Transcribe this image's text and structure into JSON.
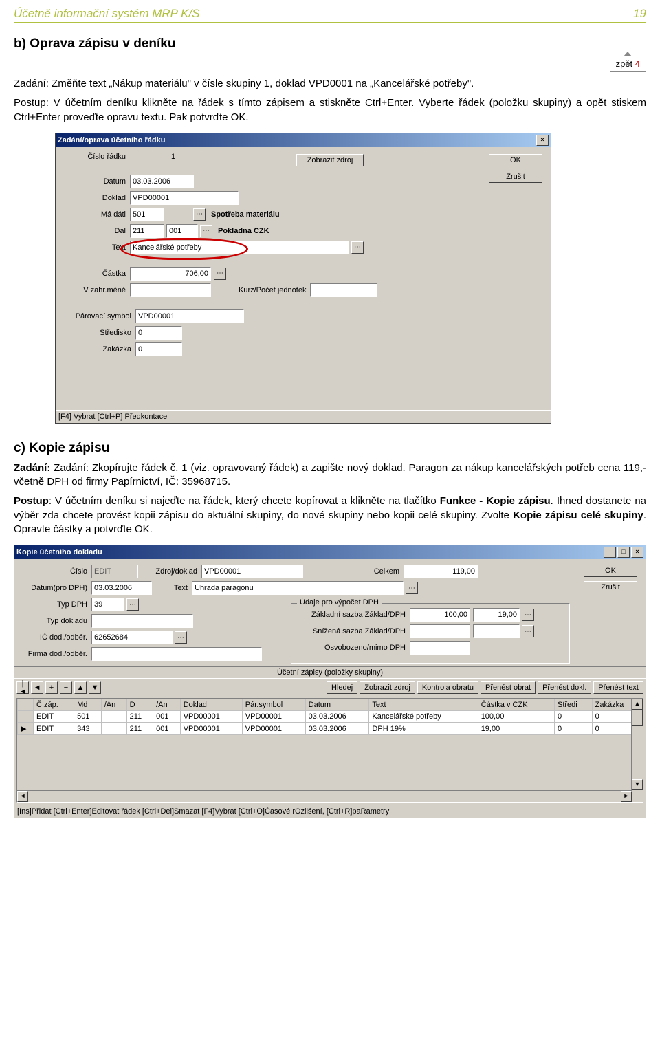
{
  "header": {
    "title": "Účetně informační systém MRP K/S",
    "page": "19"
  },
  "section_b": {
    "title": "b) Oprava zápisu v deníku",
    "back_label": "zpět ",
    "back_num": "4",
    "task": "Zadání: Změňte text „Nákup materiálu\" v čísle skupiny 1, doklad VPD0001 na „Kancelářské potřeby\".",
    "proc": "Postup:  V účetním deníku klikněte na řádek s tímto zápisem a stiskněte Ctrl+Enter. Vyberte řádek (položku skupiny) a  opět stiskem Ctrl+Enter proveďte opravu textu.  Pak potvrďte OK."
  },
  "dlg1": {
    "title": "Zadání/oprava účetního řádku",
    "btn_close": "×",
    "btn_show": "Zobrazit zdroj",
    "btn_ok": "OK",
    "btn_cancel": "Zrušit",
    "l_radek": "Číslo řádku",
    "v_radek": "1",
    "l_datum": "Datum",
    "v_datum": "03.03.2006",
    "l_doklad": "Doklad",
    "v_doklad": "VPD00001",
    "l_md": "Má dáti",
    "v_md": "501",
    "v_md_txt": "Spotřeba materiálu",
    "l_dal": "Dal",
    "v_dal1": "211",
    "v_dal2": "001",
    "v_dal_txt": "Pokladna CZK",
    "l_text": "Text",
    "v_text": "Kancelářské potřeby",
    "l_castka": "Částka",
    "v_castka": "706,00",
    "l_zahr": "V zahr.měně",
    "l_kurz": "Kurz/Počet jednotek",
    "l_par": "Párovací symbol",
    "v_par": "VPD00001",
    "l_str": "Středisko",
    "v_str": "0",
    "l_zak": "Zakázka",
    "v_zak": "0",
    "status": "[F4] Vybrat  [Ctrl+P] Předkontace"
  },
  "section_c": {
    "title": "c) Kopie zápisu",
    "p1": "Zadání: Zkopírujte řádek č. 1 (viz. opravovaný řádek) a zapište nový doklad. Paragon za nákup kancelářských potřeb cena 119,- včetně DPH od firmy Papírnictví, IČ: 35968715.",
    "p2a": "Postup",
    "p2b": ": V účetním deníku si najeďte na řádek, který chcete kopírovat a klikněte na tlačítko ",
    "p2c": "Funkce - Kopie zápisu",
    "p2d": ". Ihned dostanete na výběr zda chcete provést kopii zápisu do aktuální skupiny, do nové skupiny nebo kopii celé skupiny. Zvolte ",
    "p2e": "Kopie zápisu celé skupiny",
    "p2f": ". Opravte částky a potvrďte OK."
  },
  "dlg2": {
    "title": "Kopie účetního dokladu",
    "l_cislo": "Číslo",
    "v_cislo": "EDIT",
    "l_zdroj": "Zdroj/doklad",
    "v_zdroj": "VPD00001",
    "l_celkem": "Celkem",
    "v_celkem": "119,00",
    "btn_ok": "OK",
    "btn_cancel": "Zrušit",
    "l_datumdph": "Datum(pro DPH)",
    "v_datumdph": "03.03.2006",
    "l_text": "Text",
    "v_text": "Úhrada paragonu",
    "l_typdph": "Typ DPH",
    "v_typdph": "39",
    "l_typdok": "Typ dokladu",
    "l_ic": "IČ dod./odběr.",
    "v_ic": "62652684",
    "l_firma": "Firma dod./odběr.",
    "group_title": "Údaje pro výpočet DPH",
    "l_zs": "Základní sazba Základ/DPH",
    "v_zs1": "100,00",
    "v_zs2": "19,00",
    "l_ss": "Snížená sazba Základ/DPH",
    "l_osv": "Osvobozeno/mimo DPH",
    "innerbar": "Účetní zápisy (položky skupiny)",
    "tb": {
      "first": "|◄",
      "prev": "◄",
      "add": "+",
      "del": "−",
      "up": "▲",
      "down": "▼",
      "hledej": "Hledej",
      "zobr": "Zobrazit zdroj",
      "kontrola": "Kontrola obratu",
      "pren_obr": "Přenést obrat",
      "pren_dokl": "Přenést dokl.",
      "pren_txt": "Přenést text"
    },
    "cols": [
      "Č.záp.",
      "Md",
      "/An",
      "D",
      "/An",
      "Doklad",
      "Pár.symbol",
      "Datum",
      "Text",
      "Částka v CZK",
      "Středi",
      "Zakázka"
    ],
    "rows": [
      [
        "EDIT",
        "501",
        "",
        "211",
        "001",
        "VPD00001",
        "VPD00001",
        "03.03.2006",
        "Kancelářské potřeby",
        "100,00",
        "0",
        "0"
      ],
      [
        "EDIT",
        "343",
        "",
        "211",
        "001",
        "VPD00001",
        "VPD00001",
        "03.03.2006",
        "DPH 19%",
        "19,00",
        "0",
        "0"
      ]
    ],
    "status": "[Ins]Přidat [Ctrl+Enter]Editovat řádek [Ctrl+Del]Smazat [F4]Vybrat [Ctrl+O]Časové rOzlišení, [Ctrl+R]paRametry"
  }
}
